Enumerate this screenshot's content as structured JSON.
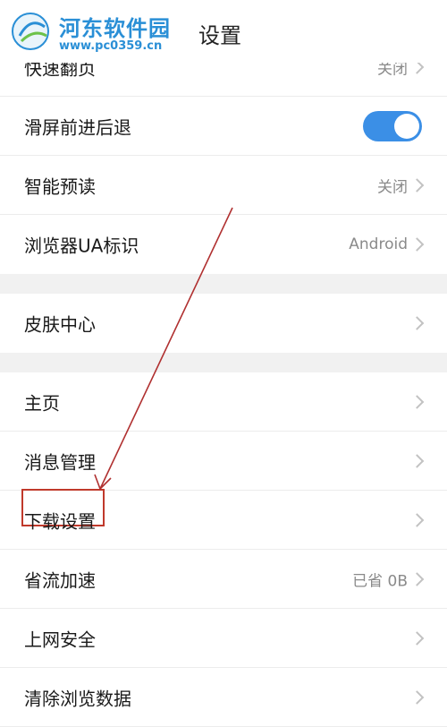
{
  "watermark": {
    "name": "河东软件园",
    "url": "www.pc0359.cn"
  },
  "header": {
    "title": "设置"
  },
  "rows": [
    {
      "label": "快速翻页",
      "value": "关闭"
    },
    {
      "label": "滑屏前进后退",
      "toggle_on": true
    },
    {
      "label": "智能预读",
      "value": "关闭"
    },
    {
      "label": "浏览器UA标识",
      "value": "Android"
    },
    {
      "label": "皮肤中心"
    },
    {
      "label": "主页"
    },
    {
      "label": "消息管理"
    },
    {
      "label": "下载设置"
    },
    {
      "label": "省流加速",
      "value": "已省 0B"
    },
    {
      "label": "上网安全"
    },
    {
      "label": "清除浏览数据"
    }
  ],
  "colors": {
    "toggle": "#3b8fe6",
    "highlight": "#c0392b",
    "arrow": "#b03030"
  }
}
